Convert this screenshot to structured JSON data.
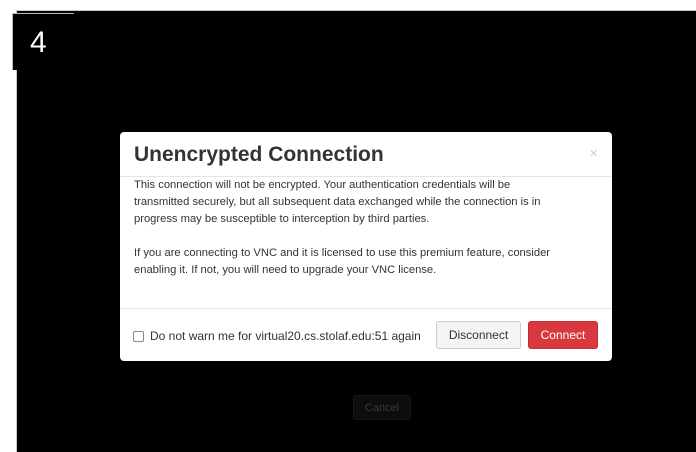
{
  "step_badge": "4",
  "background": {
    "cancel_label": "Cancel"
  },
  "modal": {
    "title": "Unencrypted Connection",
    "close_glyph": "×",
    "body": {
      "paragraph1_line1": "This connection will not be encrypted. Your authentication credentials will be",
      "paragraph1_line2": "transmitted securely, but all subsequent data exchanged while the connection is in",
      "paragraph1_line3": "progress may be susceptible to interception by third parties.",
      "paragraph2_line1": "If you are connecting to VNC and it is licensed to use this premium feature, consider",
      "paragraph2_line2": "enabling it. If not, you will need to upgrade your VNC license."
    },
    "footer": {
      "checkbox_label": "Do not warn me for virtual20.cs.stolaf.edu:51 again",
      "checkbox_checked": false,
      "disconnect_label": "Disconnect",
      "connect_label": "Connect"
    }
  },
  "colors": {
    "overlay": "#000000",
    "connect_button": "#d9383f",
    "title_text": "#333333"
  },
  "icons": {
    "close": "close-icon",
    "checkbox": "checkbox-icon"
  }
}
